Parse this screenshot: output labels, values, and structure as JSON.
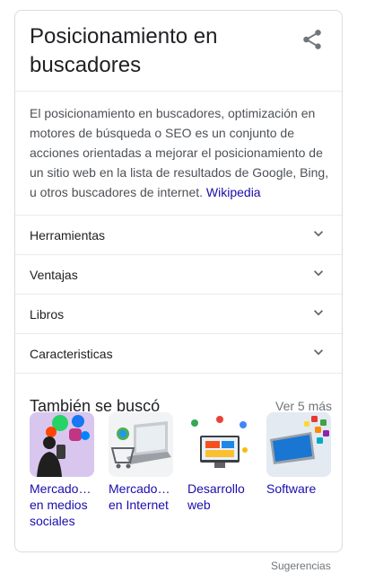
{
  "panel": {
    "title": "Posicionamiento en buscadores",
    "share_icon": "share-icon",
    "description": "El posicionamiento en buscadores, optimización en motores de búsqueda o SEO es un conjunto de acciones orientadas a mejorar el posicionamiento de un sitio web en la lista de resultados de Google, Bing, u otros buscadores de internet.",
    "source_link": "Wikipedia"
  },
  "accordion": [
    {
      "label": "Herramientas"
    },
    {
      "label": "Ventajas"
    },
    {
      "label": "Libros"
    },
    {
      "label": "Caracteristicas"
    }
  ],
  "related": {
    "title": "También se buscó",
    "more_link": "Ver 5 más",
    "items": [
      {
        "label_line1": "Mercado…",
        "label_line2": "en medios",
        "label_line3": "sociales"
      },
      {
        "label_line1": "Mercado…",
        "label_line2": "en Internet",
        "label_line3": ""
      },
      {
        "label_line1": "Desarrollo",
        "label_line2": "web",
        "label_line3": ""
      },
      {
        "label_line1": "Software",
        "label_line2": "",
        "label_line3": ""
      }
    ]
  },
  "footer": {
    "suggestions": "Sugerencias"
  },
  "colors": {
    "link": "#1a0dab",
    "text": "#202124",
    "muted": "#70757a",
    "border": "#dadce0"
  }
}
